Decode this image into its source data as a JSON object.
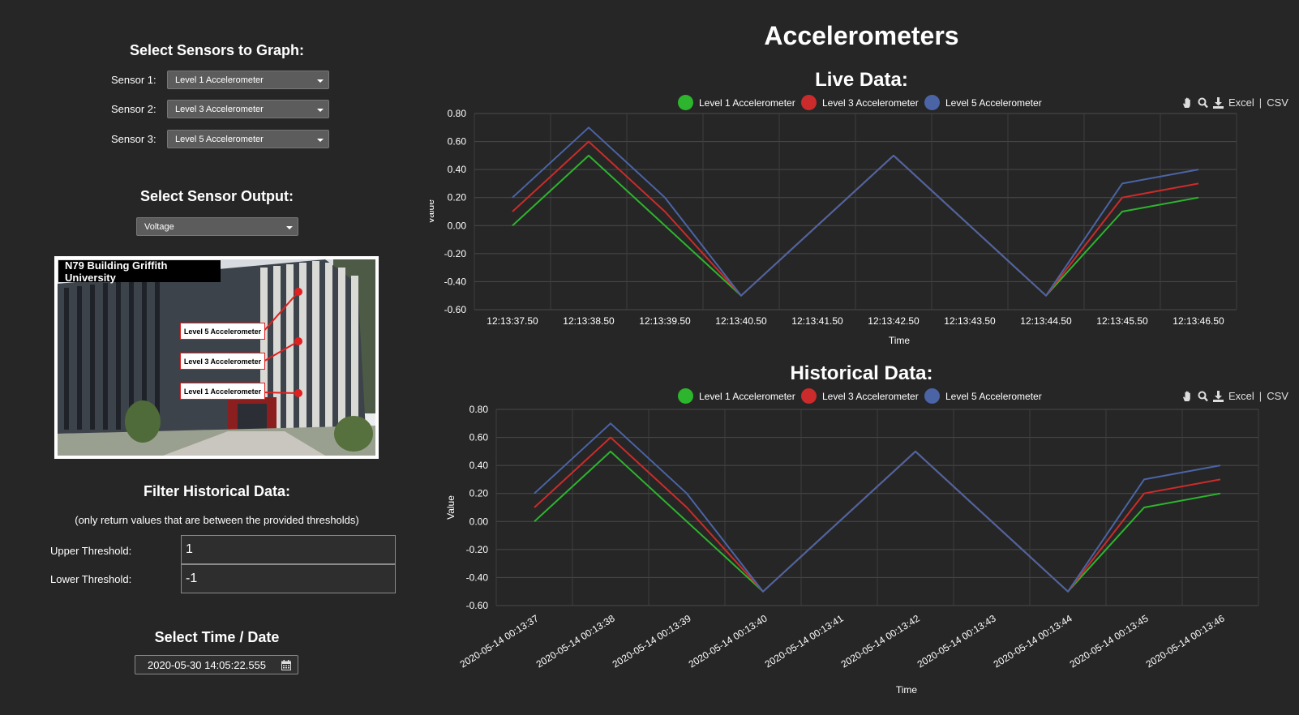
{
  "left_panel": {
    "sensors_heading": "Select Sensors to Graph:",
    "sensors": [
      {
        "label": "Sensor 1:",
        "value": "Level 1 Accelerometer"
      },
      {
        "label": "Sensor 2:",
        "value": "Level 3 Accelerometer"
      },
      {
        "label": "Sensor 3:",
        "value": "Level 5 Accelerometer"
      }
    ],
    "output_heading": "Select Sensor Output:",
    "output_value": "Voltage",
    "photo": {
      "caption": "N79 Building Griffith University",
      "callouts": [
        "Level 5 Accelerometer",
        "Level 3 Accelerometer",
        "Level 1 Accelerometer"
      ]
    },
    "filter_heading": "Filter Historical Data:",
    "filter_note": "(only return values that are between the provided thresholds)",
    "upper_label": "Upper Threshold:",
    "upper_value": "1",
    "lower_label": "Lower Threshold:",
    "lower_value": "-1",
    "time_heading": "Select Time / Date",
    "time_value": "2020-05-30 14:05:22.555",
    "time_icon": "calendar-icon"
  },
  "main": {
    "page_title": "Accelerometers",
    "toolbar": {
      "pan_icon": "hand-icon",
      "zoom_icon": "zoom-icon",
      "download_icon": "download-icon",
      "excel": "Excel",
      "separator": "|",
      "csv": "CSV"
    },
    "series_colors": [
      "#2db52d",
      "#cc2b2b",
      "#4b64a6"
    ]
  },
  "chart_data": [
    {
      "type": "line",
      "title": "Live Data:",
      "xlabel": "Time",
      "ylabel": "Value",
      "ylim": [
        -0.6,
        0.8
      ],
      "yticks": [
        "0.80",
        "0.60",
        "0.40",
        "0.20",
        "0.00",
        "-0.20",
        "-0.40",
        "-0.60"
      ],
      "legend": "top-center",
      "grid": true,
      "categories": [
        "12:13:37.50",
        "12:13:38.50",
        "12:13:39.50",
        "12:13:40.50",
        "12:13:41.50",
        "12:13:42.50",
        "12:13:43.50",
        "12:13:44.50",
        "12:13:45.50",
        "12:13:46.50"
      ],
      "series": [
        {
          "name": "Level 1 Accelerometer",
          "color": "#2db52d",
          "values": [
            0.0,
            0.5,
            null,
            -0.5,
            null,
            0.5,
            null,
            -0.5,
            0.1,
            0.2
          ]
        },
        {
          "name": "Level 3 Accelerometer",
          "color": "#cc2b2b",
          "values": [
            0.1,
            0.6,
            0.1,
            -0.5,
            null,
            0.5,
            null,
            -0.5,
            0.2,
            0.3
          ]
        },
        {
          "name": "Level 5 Accelerometer",
          "color": "#4b64a6",
          "values": [
            0.2,
            0.7,
            0.2,
            -0.5,
            null,
            0.5,
            null,
            -0.5,
            0.3,
            0.4
          ]
        }
      ]
    },
    {
      "type": "line",
      "title": "Historical Data:",
      "xlabel": "Time",
      "ylabel": "Value",
      "ylim": [
        -0.6,
        0.8
      ],
      "yticks": [
        "0.80",
        "0.60",
        "0.40",
        "0.20",
        "0.00",
        "-0.20",
        "-0.40",
        "-0.60"
      ],
      "legend": "top-center",
      "grid": true,
      "categories": [
        "2020-05-14 00:13:37",
        "2020-05-14 00:13:38",
        "2020-05-14 00:13:39",
        "2020-05-14 00:13:40",
        "2020-05-14 00:13:41",
        "2020-05-14 00:13:42",
        "2020-05-14 00:13:43",
        "2020-05-14 00:13:44",
        "2020-05-14 00:13:45",
        "2020-05-14 00:13:46"
      ],
      "series": [
        {
          "name": "Level 1 Accelerometer",
          "color": "#2db52d",
          "values": [
            0.0,
            0.5,
            null,
            -0.5,
            null,
            0.5,
            null,
            -0.5,
            0.1,
            0.2
          ]
        },
        {
          "name": "Level 3 Accelerometer",
          "color": "#cc2b2b",
          "values": [
            0.1,
            0.6,
            0.1,
            -0.5,
            null,
            0.5,
            null,
            -0.5,
            0.2,
            0.3
          ]
        },
        {
          "name": "Level 5 Accelerometer",
          "color": "#4b64a6",
          "values": [
            0.2,
            0.7,
            0.2,
            -0.5,
            null,
            0.5,
            null,
            -0.5,
            0.3,
            0.4
          ]
        }
      ]
    }
  ]
}
